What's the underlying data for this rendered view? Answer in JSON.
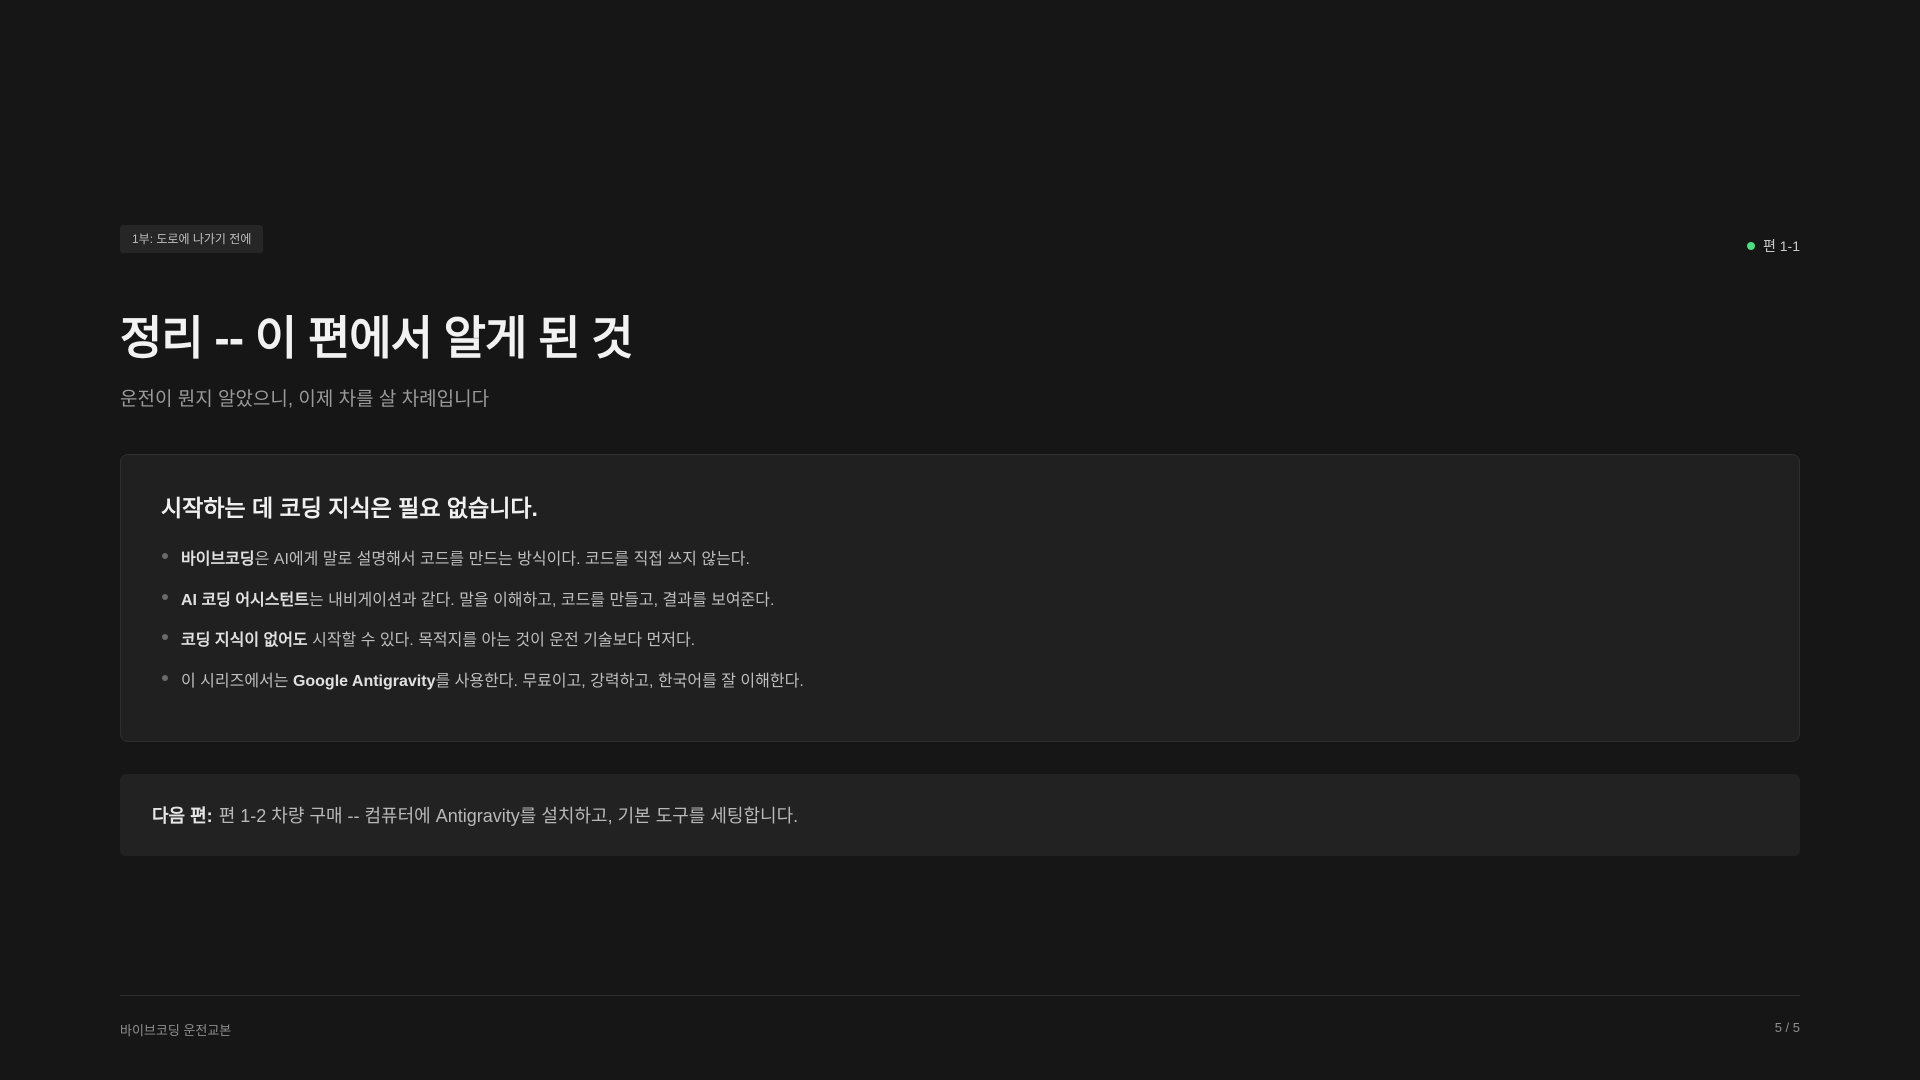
{
  "header": {
    "part_tag": "1부: 도로에 나가기 전에",
    "episode": "편 1-1",
    "episode_dot_color": "#4ade80"
  },
  "title": "정리 -- 이 편에서 알게 된 것",
  "subtitle": "운전이 뭔지 알았으니, 이제 차를 살 차례입니다",
  "summary": {
    "heading": "시작하는 데 코딩 지식은 필요 없습니다.",
    "items": [
      {
        "pre": "",
        "bold": "바이브코딩",
        "post": "은 AI에게 말로 설명해서 코드를 만드는 방식이다. 코드를 직접 쓰지 않는다."
      },
      {
        "pre": "",
        "bold": "AI 코딩 어시스턴트",
        "post": "는 내비게이션과 같다. 말을 이해하고, 코드를 만들고, 결과를 보여준다."
      },
      {
        "pre": "",
        "bold": "코딩 지식이 없어도",
        "post": " 시작할 수 있다. 목적지를 아는 것이 운전 기술보다 먼저다."
      },
      {
        "pre": "이 시리즈에서는 ",
        "bold": "Google Antigravity",
        "post": "를 사용한다. 무료이고, 강력하고, 한국어를 잘 이해한다."
      }
    ]
  },
  "next": {
    "label": "다음 편:",
    "text": "편 1-2 차량 구매 -- 컴퓨터에 Antigravity를 설치하고, 기본 도구를 세팅합니다."
  },
  "footer": {
    "left": "바이브코딩 운전교본",
    "right": "5 / 5"
  }
}
